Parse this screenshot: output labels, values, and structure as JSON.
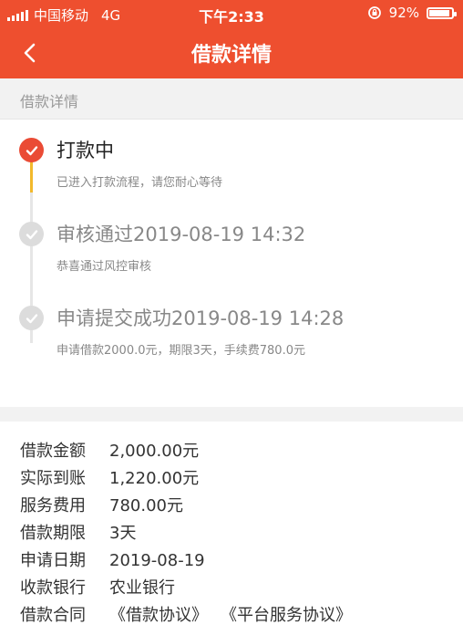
{
  "status_bar": {
    "carrier": "中国移动",
    "network": "4G",
    "time": "下午2:33",
    "battery": "92%"
  },
  "nav": {
    "title": "借款详情"
  },
  "section": {
    "title": "借款详情"
  },
  "timeline": [
    {
      "title": "打款中",
      "desc": "已进入打款流程，请您耐心等待",
      "state": "active"
    },
    {
      "title": "审核通过2019-08-19 14:32",
      "desc": "恭喜通过风控审核",
      "state": "done"
    },
    {
      "title": "申请提交成功2019-08-19 14:28",
      "desc": "申请借款2000.0元，期限3天，手续费780.0元",
      "state": "done"
    }
  ],
  "details": {
    "amount": {
      "label": "借款金额",
      "value": "2,000.00元"
    },
    "received": {
      "label": "实际到账",
      "value": "1,220.00元"
    },
    "fee": {
      "label": "服务费用",
      "value": "780.00元"
    },
    "term": {
      "label": "借款期限",
      "value": "3天"
    },
    "date": {
      "label": "申请日期",
      "value": "2019-08-19"
    },
    "bank": {
      "label": "收款银行",
      "value": "农业银行"
    },
    "contract": {
      "label": "借款合同",
      "items": [
        "《借款协议》",
        "《平台服务协议》"
      ]
    }
  },
  "colors": {
    "brand": "#ee4f2f",
    "active_node": "#ea4b35",
    "progress_line": "#f2b92b"
  }
}
